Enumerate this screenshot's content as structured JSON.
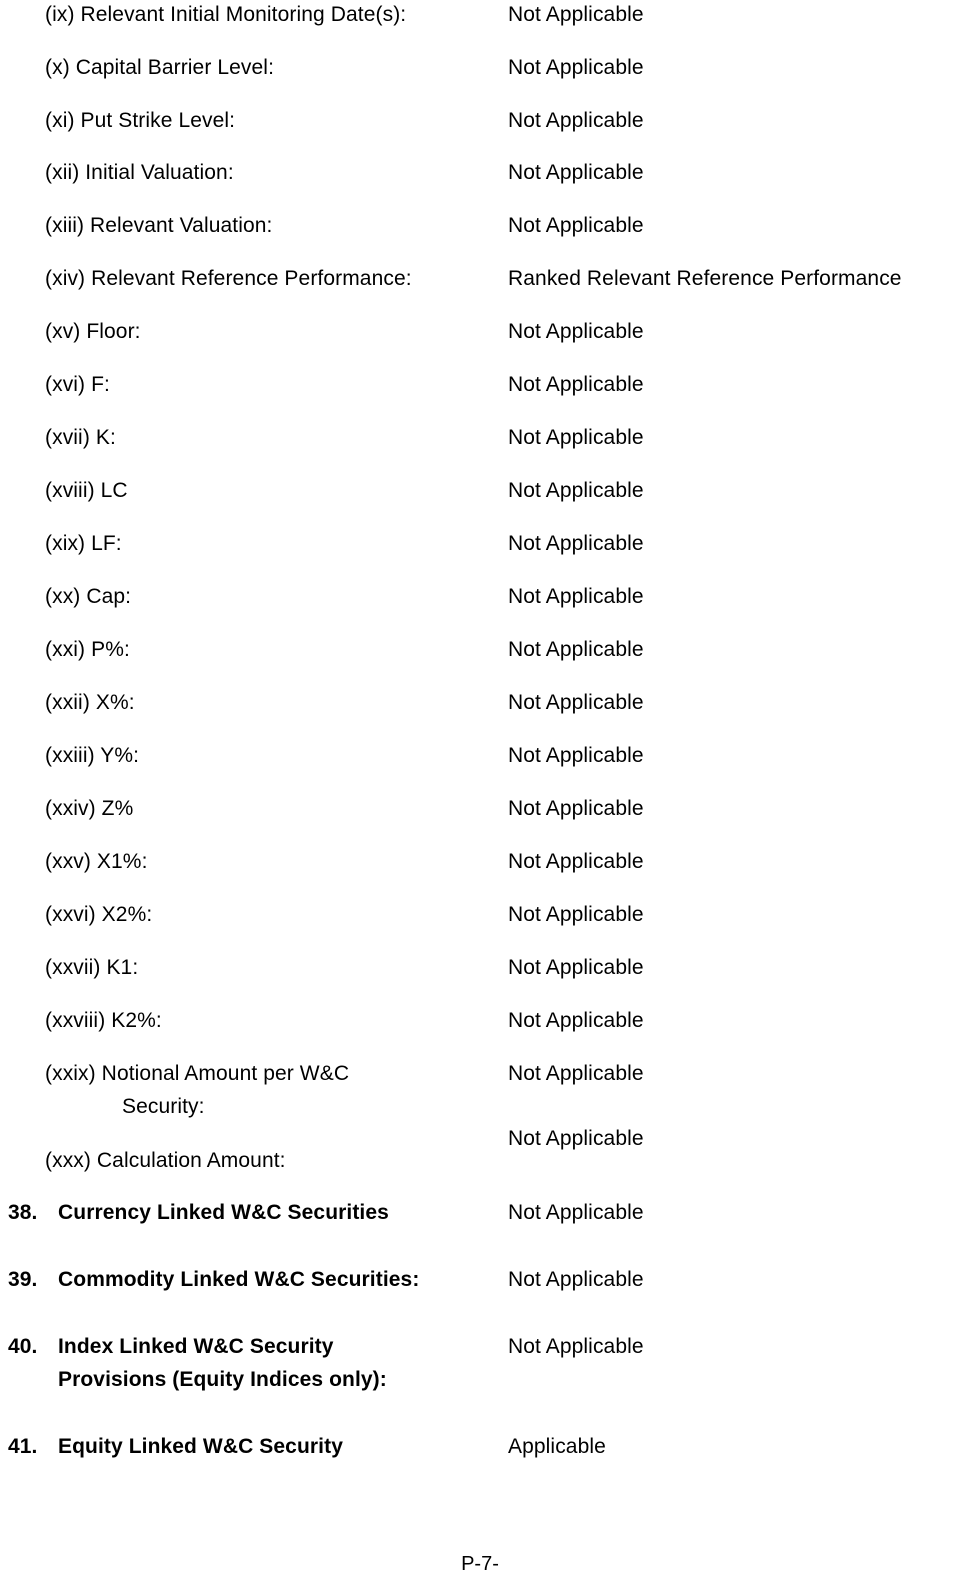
{
  "document": {
    "footer": "P-7-",
    "value_not_applicable": "Not Applicable",
    "value_applicable": "Applicable"
  },
  "sub_items": [
    {
      "label": "(ix) Relevant Initial Monitoring Date(s):",
      "value": "Not Applicable"
    },
    {
      "label": "(x) Capital Barrier Level:",
      "value": "Not Applicable"
    },
    {
      "label": "(xi) Put Strike Level:",
      "value": "Not Applicable"
    },
    {
      "label": "(xii) Initial Valuation:",
      "value": "Not Applicable"
    },
    {
      "label": "(xiii) Relevant Valuation:",
      "value": "Not Applicable"
    },
    {
      "label": "(xiv) Relevant Reference Performance:",
      "value": "Ranked Relevant Reference Performance"
    },
    {
      "label": "(xv) Floor:",
      "value": "Not Applicable"
    },
    {
      "label": "(xvi) F:",
      "value": "Not Applicable"
    },
    {
      "label": "(xvii) K:",
      "value": "Not Applicable"
    },
    {
      "label": "(xviii) LC",
      "value": "Not Applicable"
    },
    {
      "label": "(xix) LF:",
      "value": "Not Applicable"
    },
    {
      "label": "(xx) Cap:",
      "value": "Not Applicable"
    },
    {
      "label": "(xxi) P%:",
      "value": "Not Applicable"
    },
    {
      "label": "(xxii) X%:",
      "value": "Not Applicable"
    },
    {
      "label": "(xxiii) Y%:",
      "value": "Not Applicable"
    },
    {
      "label": "(xxiv) Z%",
      "value": "Not Applicable"
    },
    {
      "label": "(xxv) X1%:",
      "value": "Not Applicable"
    },
    {
      "label": "(xxvi) X2%:",
      "value": "Not Applicable"
    },
    {
      "label": "(xxvii) K1:",
      "value": "Not Applicable"
    },
    {
      "label": "(xxviii) K2%:",
      "value": "Not Applicable"
    }
  ],
  "notional_item": {
    "label_line1": "(xxix) Notional Amount per W&C",
    "label_line2": "Security:",
    "value": "Not Applicable"
  },
  "calculation_item": {
    "label": "(xxx) Calculation Amount:",
    "value": "Not Applicable"
  },
  "numbered_items": [
    {
      "number": "38.",
      "label_line1": "Currency Linked W&C Securities",
      "label_line2": "",
      "value": "Not Applicable"
    },
    {
      "number": "39.",
      "label_line1": "Commodity Linked W&C Securities:",
      "label_line2": "",
      "value": "Not Applicable"
    },
    {
      "number": "40.",
      "label_line1": "Index Linked W&C Security",
      "label_line2": "Provisions (Equity Indices only):",
      "value": "Not Applicable"
    },
    {
      "number": "41.",
      "label_line1": "Equity Linked W&C Security",
      "label_line2": "",
      "value": "Applicable"
    }
  ]
}
